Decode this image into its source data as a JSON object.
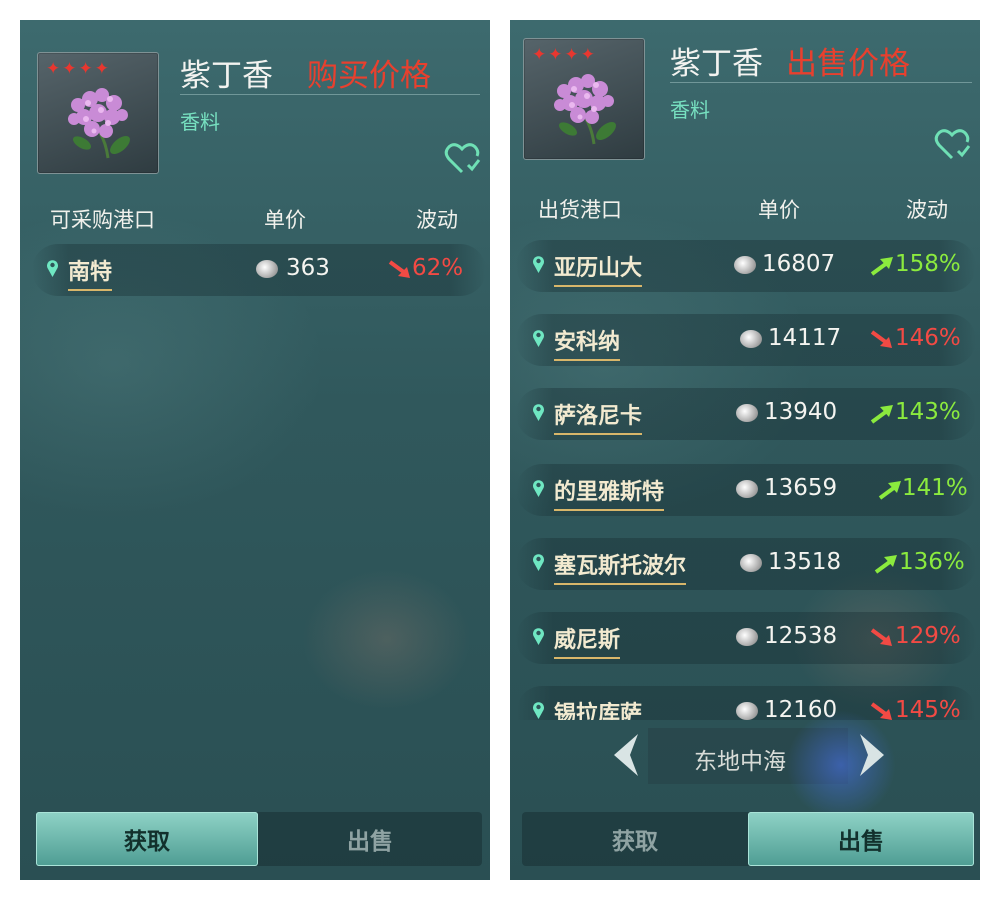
{
  "left_panel": {
    "item_name": "紫丁香",
    "price_label": "购买价格",
    "category": "香料",
    "stars": "✦✦✦✦",
    "columns": {
      "port": "可采购港口",
      "price": "单价",
      "change": "波动"
    },
    "rows": [
      {
        "port": "南特",
        "price": "363",
        "change": "62%",
        "trend": "down"
      }
    ],
    "tabs": {
      "acquire": "获取",
      "sell": "出售",
      "active": "acquire"
    }
  },
  "right_panel": {
    "item_name": "紫丁香",
    "price_label": "出售价格",
    "category": "香料",
    "stars": "✦✦✦✦",
    "columns": {
      "port": "出货港口",
      "price": "单价",
      "change": "波动"
    },
    "rows": [
      {
        "port": "亚历山大",
        "price": "16807",
        "change": "158%",
        "trend": "up"
      },
      {
        "port": "安科纳",
        "price": "14117",
        "change": "146%",
        "trend": "down"
      },
      {
        "port": "萨洛尼卡",
        "price": "13940",
        "change": "143%",
        "trend": "up"
      },
      {
        "port": "的里雅斯特",
        "price": "13659",
        "change": "141%",
        "trend": "up"
      },
      {
        "port": "塞瓦斯托波尔",
        "price": "13518",
        "change": "136%",
        "trend": "up"
      },
      {
        "port": "威尼斯",
        "price": "12538",
        "change": "129%",
        "trend": "down"
      },
      {
        "port": "锡拉库萨",
        "price": "12160",
        "change": "145%",
        "trend": "down"
      }
    ],
    "region": "东地中海",
    "tabs": {
      "acquire": "获取",
      "sell": "出售",
      "active": "sell"
    }
  },
  "icons": {
    "favorite": "heart-check-icon",
    "location": "map-pin-icon",
    "currency": "silver-coin-icon"
  },
  "colors": {
    "up": "#8bea3e",
    "down": "#f24a44",
    "price_label": "#e8402e",
    "category": "#77e0c0",
    "accent_tab": "#6bb9ad"
  }
}
